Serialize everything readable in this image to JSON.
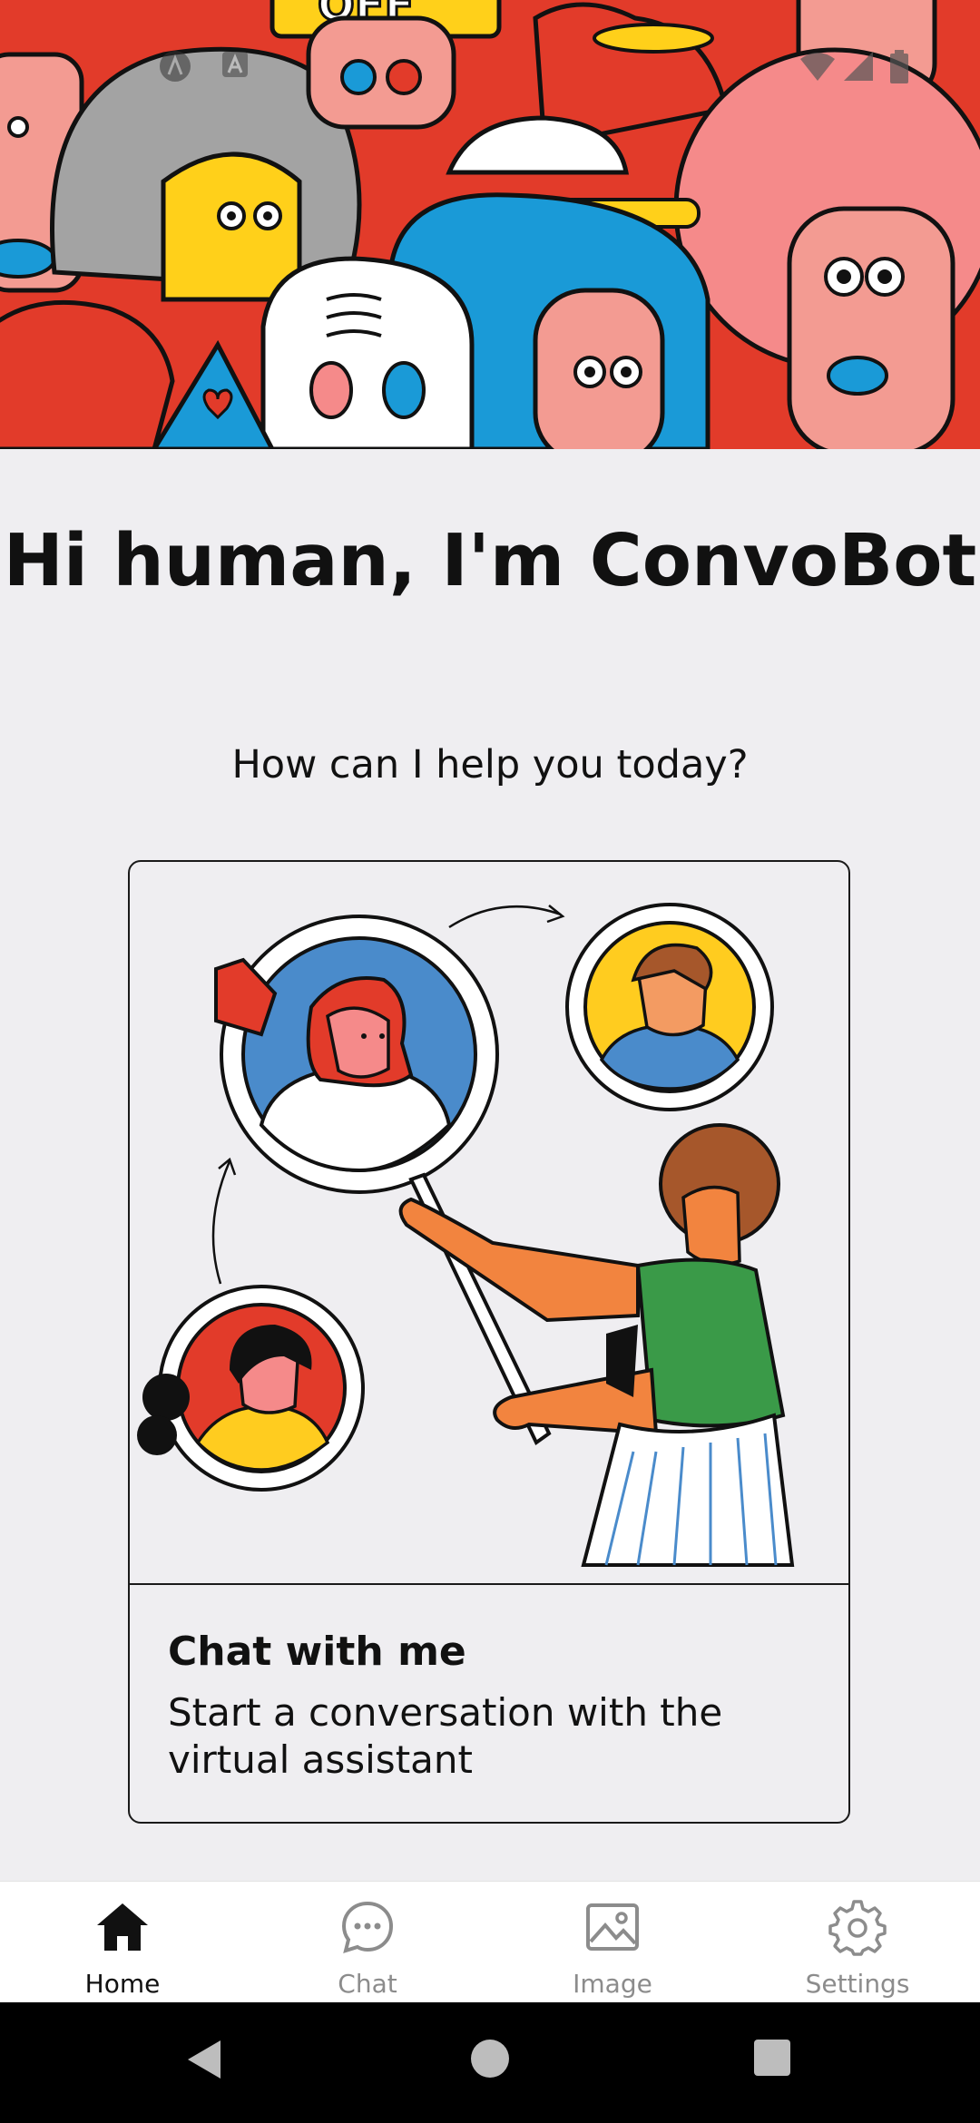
{
  "hero": {
    "alt": "illustrated crowd of cartoon faces"
  },
  "status_bar": {
    "icons": [
      "notification-a-icon",
      "notification-a-icon",
      "wifi-icon",
      "signal-icon",
      "battery-icon"
    ]
  },
  "main": {
    "title": "Hi human, I'm ConvoBot",
    "subtitle": "How can I help you today?"
  },
  "card": {
    "title": "Chat with me",
    "description": "Start a conversation with the virtual assistant"
  },
  "bottom_nav": {
    "items": [
      {
        "label": "Home",
        "icon": "home-icon",
        "active": true
      },
      {
        "label": "Chat",
        "icon": "chat-bubble-icon",
        "active": false
      },
      {
        "label": "Image",
        "icon": "image-icon",
        "active": false
      },
      {
        "label": "Settings",
        "icon": "gear-icon",
        "active": false
      }
    ]
  },
  "system_nav": {
    "buttons": [
      "back-icon",
      "home-circle-icon",
      "recents-square-icon"
    ]
  },
  "colors": {
    "background": "#efeef1",
    "nav_active": "#111111",
    "nav_inactive": "#8c8c8c"
  }
}
